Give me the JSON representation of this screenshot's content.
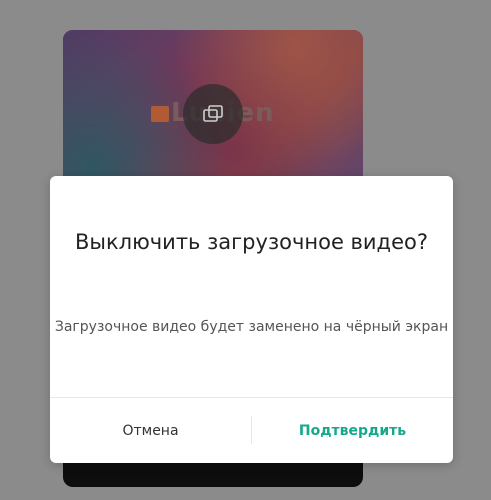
{
  "background": {
    "overlay_color": "#8b8b8b"
  },
  "preview": {
    "logo_text": "Luaien",
    "center_icon": "layers-icon"
  },
  "dialog": {
    "title": "Выключить загрузочное видео?",
    "message": "Загрузочное видео будет заменено на чёрный экран",
    "cancel_label": "Отмена",
    "confirm_label": "Подтвердить",
    "accent_color": "#16a88a"
  }
}
